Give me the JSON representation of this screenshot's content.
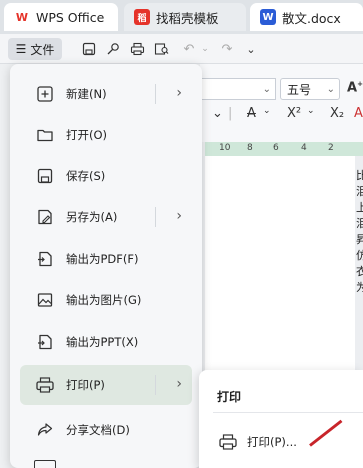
{
  "tabs": [
    {
      "label": "WPS Office",
      "icon": "wps-logo-icon",
      "icon_glyph": "W"
    },
    {
      "label": "找稻壳模板",
      "icon": "docer-icon",
      "icon_glyph": "稻"
    },
    {
      "label": "散文.docx",
      "icon": "word-doc-icon",
      "icon_glyph": "W"
    }
  ],
  "toolbar": {
    "file_label": "文件",
    "font_size_value": "五号"
  },
  "ruler": {
    "marks": [
      "10",
      "8",
      "6",
      "4",
      "2"
    ]
  },
  "file_menu": {
    "items": [
      {
        "label": "新建(N)",
        "icon": "new-document-icon",
        "has_submenu": true
      },
      {
        "label": "打开(O)",
        "icon": "open-folder-icon",
        "has_submenu": false
      },
      {
        "label": "保存(S)",
        "icon": "save-icon",
        "has_submenu": false
      },
      {
        "label": "另存为(A)",
        "icon": "save-as-icon",
        "has_submenu": true
      },
      {
        "label": "输出为PDF(F)",
        "icon": "export-pdf-icon",
        "has_submenu": false
      },
      {
        "label": "输出为图片(G)",
        "icon": "export-image-icon",
        "has_submenu": false
      },
      {
        "label": "输出为PPT(X)",
        "icon": "export-ppt-icon",
        "has_submenu": false
      },
      {
        "label": "打印(P)",
        "icon": "print-icon",
        "has_submenu": true,
        "active": true
      },
      {
        "label": "分享文档(D)",
        "icon": "share-icon",
        "has_submenu": false
      }
    ]
  },
  "print_submenu": {
    "title": "打印",
    "items": [
      {
        "label": "打印(P)...",
        "icon": "printer-icon"
      }
    ]
  },
  "doc_text_chars": [
    "比",
    "泪",
    "上",
    "泪",
    "昇",
    "仿",
    "衣",
    "为"
  ],
  "colors": {
    "accent_active": "#dfe8e1",
    "wps_red": "#e5332a",
    "word_blue": "#2b5cd6",
    "ruler_green": "#cfe7d9"
  }
}
